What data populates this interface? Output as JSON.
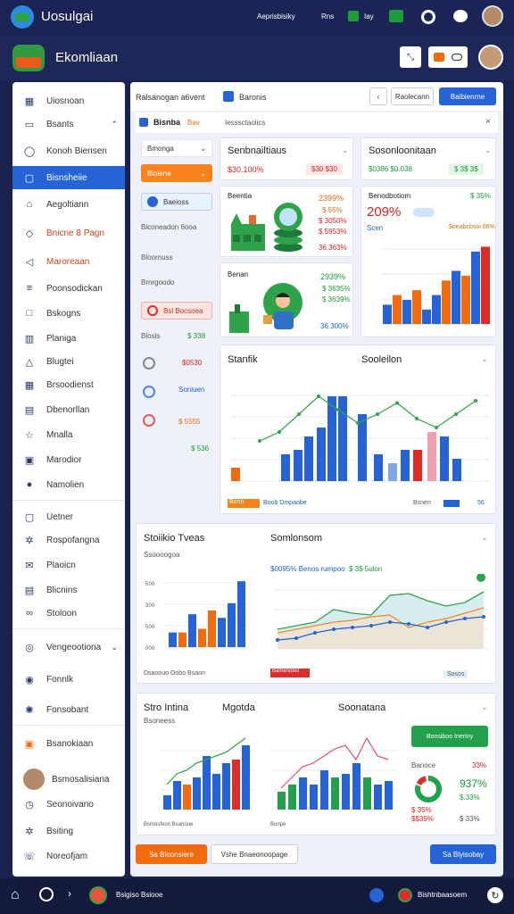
{
  "topbar": {
    "app_name": "Uosulgai",
    "nav_link": "Aeprisbisiky",
    "chip1": "Rns",
    "chip2": "Iay"
  },
  "header": {
    "title": "Ekomliaan"
  },
  "sidebar": {
    "items": [
      {
        "label": "Uiosnoan",
        "icon": "dashboard-icon"
      },
      {
        "label": "Bsants",
        "icon": "folder-icon"
      },
      {
        "label": "Konoh Biensen",
        "icon": "chat-icon"
      },
      {
        "label": "Bisnsheiie",
        "icon": "document-icon"
      },
      {
        "label": "Aegoltiann",
        "icon": "home-icon"
      },
      {
        "label": "Bnicne 8 Pagn",
        "icon": "tag-icon"
      },
      {
        "label": "Maroreaan",
        "icon": "megaphone-icon"
      },
      {
        "label": "Poonsodickan",
        "icon": "list-icon"
      },
      {
        "label": "Bskogns",
        "icon": "box-icon"
      },
      {
        "label": "Planiga",
        "icon": "chart-icon"
      },
      {
        "label": "Blugtei",
        "icon": "bell-icon"
      },
      {
        "label": "Brsoodienst",
        "icon": "grid-icon"
      },
      {
        "label": "Dbenorllan",
        "icon": "calendar-icon"
      },
      {
        "label": "Mnalla",
        "icon": "star-icon"
      },
      {
        "label": "Marodior",
        "icon": "lock-icon"
      },
      {
        "label": "Namolien",
        "icon": "circle-icon"
      },
      {
        "label": "Uetner",
        "icon": "frame-icon"
      },
      {
        "label": "Rospofangna",
        "icon": "gear-icon"
      },
      {
        "label": "Plaoicn",
        "icon": "mail-icon"
      },
      {
        "label": "Blicnins",
        "icon": "page-icon"
      },
      {
        "label": "Stoloon",
        "icon": "link-icon"
      },
      {
        "label": "Vengeootiona",
        "icon": "globe-icon"
      },
      {
        "label": "Fonnlk",
        "icon": "pin-icon"
      },
      {
        "label": "Fonsobant",
        "icon": "settings-icon"
      },
      {
        "label": "Bsanokiaan",
        "icon": "lock-user-icon"
      },
      {
        "label": "Bsmosalisiana",
        "icon": "avatar"
      },
      {
        "label": "Seonoivano",
        "icon": "clock-icon"
      },
      {
        "label": "Bsiting",
        "icon": "gear-icon"
      },
      {
        "label": "Noreofjam",
        "icon": "phone-icon"
      }
    ]
  },
  "toolbar": {
    "breadcrumb": "Ralsanogan a6vent",
    "page": "Baronis",
    "btn_secondary": "Raolecann",
    "btn_primary": "Balbienrne"
  },
  "panel": {
    "title": "Bisnba",
    "title_tag": "Bav",
    "subtitle": "Iesssctaoiics"
  },
  "left_panel": {
    "select1": "Bmonga",
    "orange_btn": "Bioiene",
    "blue_chip": "Baeioss",
    "row1": "Biconeadon 6ooa",
    "row2": "Bloornuss",
    "row3": "Brnrgoodo",
    "red_chip": "Bsl Bocsoea",
    "row4_label": "Blosls",
    "row4_value": "$ 338",
    "row5_label": "$0530",
    "row6_label": "Soniuen",
    "row7_value": "$ 5555",
    "row8_value": "$ 536"
  },
  "cards": {
    "c1": {
      "title": "Senbnailtiaus",
      "sub": "$30.100%",
      "badge": "$30 $30"
    },
    "c2": {
      "title": "Sosonloonitaan",
      "sub": "$0386 $0.038",
      "badge": "$ 3$ 3$"
    },
    "c3": {
      "title": "Beentia",
      "vals": [
        "2399%",
        "$.55%",
        "$ 3050%",
        "$.5953%",
        "36.363%"
      ]
    },
    "c4": {
      "title": "Benodbotiom",
      "big": "209%",
      "badge": "$ 35%",
      "small1": "Scen",
      "small2": "$oeabcbsoi 66%"
    },
    "c5": {
      "title": "Benan",
      "vals": [
        "2939%",
        "$ 3635%",
        "$ 3639%",
        "36.300%"
      ]
    }
  },
  "chart1": {
    "title": "Stanfik",
    "title2": "Sooleilon",
    "legend1": "Bonn",
    "legend2": "Boob Dmpaobe",
    "legend3": "Bsnen",
    "legend4": "56"
  },
  "chart2": {
    "title": "Stoiikio Tveas",
    "sub": "Ssoooogoa",
    "legend": "Dsaoouo Oobo Bsaon",
    "tag": "Bamenoteii"
  },
  "chart3": {
    "title": "Somlonsom",
    "highlight": "$0095% Benos rumpoo",
    "highlight2": "$ 3$ 5ulon",
    "tag": "Sosos"
  },
  "bottom_card": {
    "title": "Stro Intina",
    "sub": "Bsoneess",
    "title2": "Mgotda",
    "title3": "Soonatana",
    "green_btn": "Bonsiboo Ineriny",
    "stat_label": "Banoce",
    "stat_value": "33%",
    "stat_big": "937%",
    "stat_a": "$ 35%",
    "stat_b": "$.33%",
    "stat_c": "$$39%",
    "stat_d": "$ 33%",
    "legend": "Bsmosfeon Bsanoue",
    "legend2": "Bonpe"
  },
  "footer_buttons": {
    "orange": "Sa Bloonsiere",
    "outline": "Vshe Bnaeonoopage",
    "blue": "Sa Blyisobay"
  },
  "bottom_bar": {
    "app_label": "Bsigiso Bsiooe",
    "right_label": "Bishtnbaasoem"
  },
  "colors": {
    "blue": "#2563d6",
    "orange": "#f26b0f",
    "green": "#22a04b",
    "red": "#e02b2b",
    "navy": "#1b2454"
  },
  "chart_data": [
    {
      "type": "line",
      "series": [
        {
          "values": [
            18,
            22,
            30,
            38,
            32,
            26,
            30,
            35,
            28,
            24,
            30,
            36
          ]
        }
      ]
    },
    {
      "type": "bar",
      "series": [
        {
          "values": [
            6,
            12,
            14,
            20,
            24,
            38,
            38,
            30,
            12,
            8,
            14,
            14,
            22,
            20,
            10
          ]
        }
      ]
    }
  ]
}
